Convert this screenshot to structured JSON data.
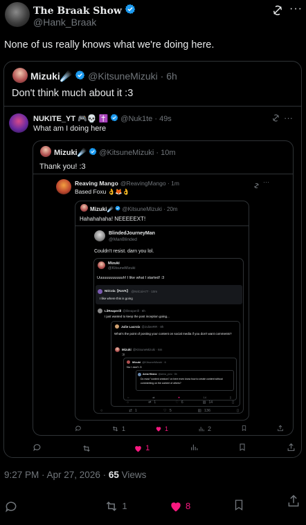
{
  "main": {
    "author_name": "The Braak Show",
    "author_handle": "@Hank_Braak",
    "text": "None of us really knows what we're doing here.",
    "timestamp": "9:27 PM · Apr 27, 2026 · ",
    "views_count": "65",
    "views_label": "Views",
    "replies": "",
    "retweets": "1",
    "likes": "8"
  },
  "q1": {
    "name": "Mizuki",
    "name_emoji": "☄️",
    "handle": "@KitsuneMizuki · 6h",
    "text": "Don't think much about it :3"
  },
  "q2": {
    "name": "NUKITE_YT",
    "name_emoji": "🎮💀 ✝️",
    "handle": "@Nuk1te · 49s",
    "text": "What am I doing here",
    "retweets": "",
    "likes": "1"
  },
  "q3": {
    "name": "Mizuki",
    "name_emoji": "☄️",
    "handle": "@KitsuneMizuki · 10m",
    "text": "Thank you! :3",
    "retweets": "1",
    "likes": "1",
    "views": "2"
  },
  "q4": {
    "name": "Reaving Mango",
    "handle": "@ReavingMango · 1m",
    "text": "Based Foxu 👌🦊👌"
  },
  "q5": {
    "name": "Mizuki",
    "name_emoji": "☄️",
    "handle": "@KitsuneMizuki · 20m",
    "text": "Hahahahaha! NEEEEEXT!"
  },
  "q6": {
    "name": "BlindedJourneyMan",
    "handle": "@ManBlinded",
    "text": "Couldn't resist. darn you lol."
  },
  "q7": {
    "name": "Mizuki",
    "handle": "@KitsuneMizuki",
    "text": "Uuuuuuuuuuuuh! I like what I started! :3",
    "retweets": "1",
    "likes": "1",
    "views": "2"
  },
  "q8": {
    "name": "NIiCola【RaVK】",
    "handle": "@NIiColA77 · 10m",
    "text": "I like where this is going"
  },
  "q9": {
    "name": "LilReaperill",
    "handle": "@lilreaperill · 8h",
    "text": "I just wanted to keep the post inception going..."
  },
  "q10": {
    "name": "Julie Lacroix",
    "handle": "@JulieeRR · 8h",
    "text": "What's the point of posting your content on social media if you don't want comments?"
  },
  "q11": {
    "name": "Mizuki",
    "handle": "@KitsuneMizuki · 6m",
    "text": ":3"
  },
  "q12": {
    "name": "Mizuki",
    "handle": "@KitsuneMizuki · 6",
    "text": "No I don't :3"
  },
  "q13": {
    "name": "Aena Hirano",
    "handle": "@aena_yoru · 8h",
    "text": "Do most \"content creators\" on here even know how to create content without commenting on the content of others?"
  },
  "mini_stats": {
    "a": "1",
    "b": "6",
    "c": "14",
    "d": "1",
    "e": "5",
    "f": "136"
  }
}
